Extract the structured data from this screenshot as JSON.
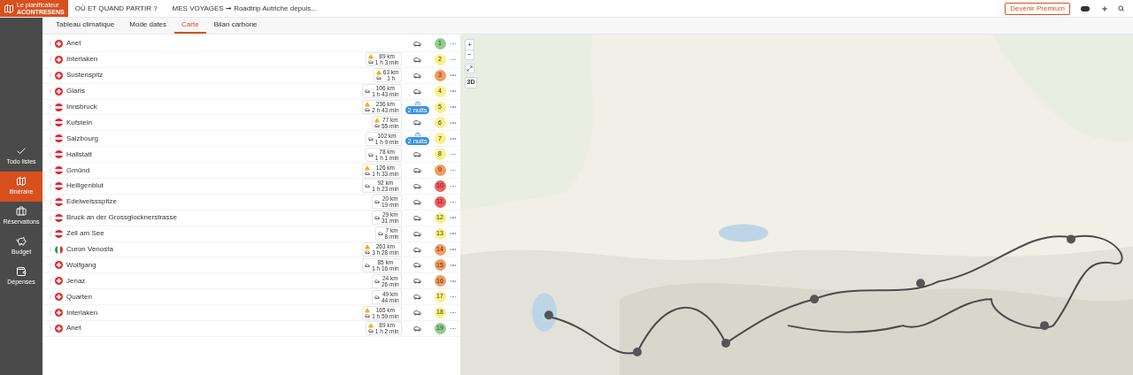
{
  "header": {
    "logo_line1": "Le planificateur",
    "logo_line2": "ACONTRESENS",
    "nav": [
      "OÙ ET QUAND PARTIR ?",
      "MES VOYAGES ➞ Roadtrip Autriche depuis..."
    ],
    "premium": "Devenir Premium"
  },
  "tabs": [
    {
      "label": "Tableau climatique",
      "selected": false
    },
    {
      "label": "Mode dates",
      "selected": false
    },
    {
      "label": "Carte",
      "selected": true
    },
    {
      "label": "Bilan carbone",
      "selected": false
    }
  ],
  "sidebar": [
    {
      "label": "Todo listes",
      "selected": false
    },
    {
      "label": "Itinéraire",
      "selected": true
    },
    {
      "label": "Réservations",
      "selected": false
    },
    {
      "label": "Budget",
      "selected": false
    },
    {
      "label": "Dépenses",
      "selected": false
    }
  ],
  "stops": [
    {
      "name": "Anet",
      "kind": "ch",
      "number": "1",
      "color": "#8fcf8f"
    },
    {
      "name": "Interlaken",
      "kind": "ch",
      "warning": true,
      "distance": "89 km",
      "duration": "1 h 3 min",
      "number": "2",
      "color": "#fbf08a"
    },
    {
      "name": "Sustenspitz",
      "kind": "ch",
      "warning": true,
      "distance": "63 km",
      "duration": "1 h",
      "number": "3",
      "color": "#f79a5c"
    },
    {
      "name": "Glaris",
      "kind": "ch",
      "warning": false,
      "distance": "106 km",
      "duration": "1 h 43 min",
      "number": "4",
      "color": "#fbf08a"
    },
    {
      "name": "Innsbruck",
      "kind": "at",
      "warning": true,
      "distance": "236 km",
      "duration": "2 h 43 min",
      "nights": "2 nuits",
      "number": "5",
      "color": "#fbf08a"
    },
    {
      "name": "Kufstein",
      "kind": "at",
      "warning": true,
      "distance": "77 km",
      "duration": "55 min",
      "number": "6",
      "color": "#fbf08a"
    },
    {
      "name": "Salzbourg",
      "kind": "at",
      "warning": false,
      "distance": "102 km",
      "duration": "1 h 9 min",
      "nights": "2 nuits",
      "number": "7",
      "color": "#fbf08a"
    },
    {
      "name": "Hallstatt",
      "kind": "at",
      "warning": false,
      "distance": "78 km",
      "duration": "1 h 1 min",
      "number": "8",
      "color": "#fbf08a"
    },
    {
      "name": "Gmünd",
      "kind": "at",
      "warning": true,
      "distance": "126 km",
      "duration": "1 h 33 min",
      "number": "9",
      "color": "#f79a5c"
    },
    {
      "name": "Heiligenblut",
      "kind": "at",
      "warning": false,
      "distance": "92 km",
      "duration": "1 h 23 min",
      "number": "10",
      "color": "#f25c5c"
    },
    {
      "name": "Edelweissspitze",
      "kind": "at",
      "warning": false,
      "distance": "20 km",
      "duration": "19 min",
      "number": "11",
      "color": "#f25c5c"
    },
    {
      "name": "Bruck an der Grossglocknerstrasse",
      "kind": "at",
      "warning": false,
      "distance": "29 km",
      "duration": "31 min",
      "number": "12",
      "color": "#fbf08a"
    },
    {
      "name": "Zell am See",
      "kind": "at",
      "warning": false,
      "distance": "7 km",
      "duration": "8 min",
      "number": "13",
      "color": "#fbf08a"
    },
    {
      "name": "Curon Venosta",
      "kind": "it",
      "warning": true,
      "distance": "263 km",
      "duration": "3 h 28 min",
      "number": "14",
      "color": "#f79a5c"
    },
    {
      "name": "Wolfgang",
      "kind": "ch",
      "warning": false,
      "distance": "85 km",
      "duration": "1 h 16 min",
      "number": "15",
      "color": "#f79a5c"
    },
    {
      "name": "Jenaz",
      "kind": "ch",
      "warning": false,
      "distance": "24 km",
      "duration": "26 min",
      "number": "16",
      "color": "#f79a5c"
    },
    {
      "name": "Quarten",
      "kind": "ch",
      "warning": false,
      "distance": "49 km",
      "duration": "44 min",
      "number": "17",
      "color": "#fbf08a"
    },
    {
      "name": "Interlaken",
      "kind": "ch",
      "warning": true,
      "distance": "165 km",
      "duration": "1 h 59 min",
      "number": "18",
      "color": "#fbf08a"
    },
    {
      "name": "Anet",
      "kind": "ch",
      "warning": true,
      "distance": "89 km",
      "duration": "1 h 2 min",
      "number": "19",
      "color": "#8fcf8f"
    }
  ],
  "map": {
    "controls": [
      "+",
      "−",
      "3D"
    ]
  }
}
